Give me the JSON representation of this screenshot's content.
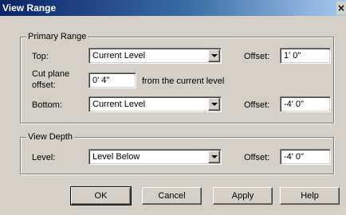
{
  "window": {
    "title": "View Range",
    "close_label": "×"
  },
  "primary_range": {
    "title": "Primary Range",
    "top": {
      "label": "Top:",
      "value": "Current Level",
      "offset_label": "Offset:",
      "offset_value": "1' 0\""
    },
    "cut_plane": {
      "label_line1": "Cut plane",
      "label_line2": "offset:",
      "value": "0' 4\"",
      "suffix": "from the current level"
    },
    "bottom": {
      "label": "Bottom:",
      "value": "Current Level",
      "offset_label": "Offset:",
      "offset_value": "-4' 0\""
    }
  },
  "view_depth": {
    "title": "View Depth",
    "level": {
      "label": "Level:",
      "value": "Level Below",
      "offset_label": "Offset:",
      "offset_value": "-4' 0\""
    }
  },
  "buttons": {
    "ok": "OK",
    "cancel": "Cancel",
    "apply": "Apply",
    "help": "Help"
  }
}
